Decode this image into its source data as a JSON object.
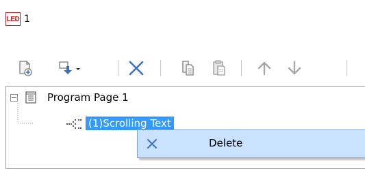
{
  "led": {
    "badge": "LED",
    "number": "1"
  },
  "toolbar": {
    "items": [
      {
        "name": "add-page-icon"
      },
      {
        "name": "add-item-dropdown-icon"
      },
      {
        "name": "delete-icon"
      },
      {
        "name": "copy-icon"
      },
      {
        "name": "paste-icon"
      },
      {
        "name": "move-up-icon"
      },
      {
        "name": "move-down-icon"
      }
    ]
  },
  "tree": {
    "root": {
      "label": "Program Page 1"
    },
    "child": {
      "label": "(1)Scrolling Text",
      "selected": true
    }
  },
  "context_menu": {
    "items": [
      {
        "label": "Delete",
        "icon": "delete-x-icon"
      }
    ]
  },
  "colors": {
    "accent_blue": "#3399ff",
    "menu_highlight": "#c9e2ff",
    "led_red": "#c21d1d",
    "icon_blue": "#3b6ecf"
  }
}
